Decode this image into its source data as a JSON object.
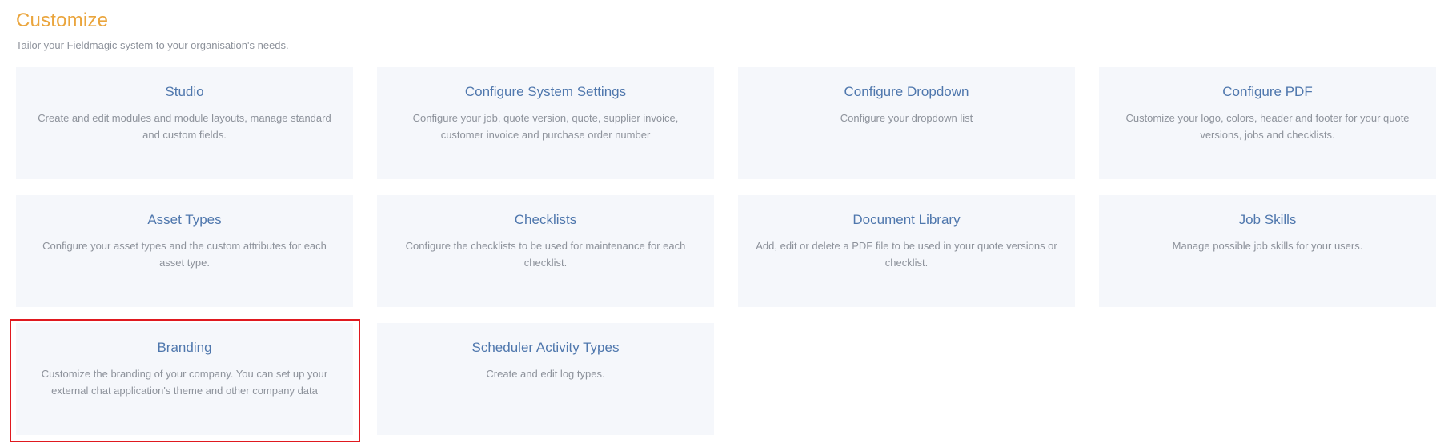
{
  "header": {
    "title": "Customize",
    "subtitle": "Tailor your Fieldmagic system to your organisation's needs."
  },
  "cards": [
    {
      "title": "Studio",
      "description": "Create and edit modules and module layouts, manage standard and custom fields."
    },
    {
      "title": "Configure System Settings",
      "description": "Configure your job, quote version, quote, supplier invoice, customer invoice and purchase order number"
    },
    {
      "title": "Configure Dropdown",
      "description": "Configure your dropdown list"
    },
    {
      "title": "Configure PDF",
      "description": "Customize your logo, colors, header and footer for your quote versions, jobs and checklists."
    },
    {
      "title": "Asset Types",
      "description": "Configure your asset types and the custom attributes for each asset type."
    },
    {
      "title": "Checklists",
      "description": "Configure the checklists to be used for maintenance for each checklist."
    },
    {
      "title": "Document Library",
      "description": "Add, edit or delete a PDF file to be used in your quote versions or checklist."
    },
    {
      "title": "Job Skills",
      "description": "Manage possible job skills for your users."
    },
    {
      "title": "Branding",
      "description": "Customize the branding of your company. You can set up your external chat application's theme and other company data"
    },
    {
      "title": "Scheduler Activity Types",
      "description": "Create and edit log types."
    }
  ],
  "colors": {
    "title": "#eaa53d",
    "card_title": "#4f77ad",
    "card_background": "#f5f7fb",
    "highlight_border": "#e0191f"
  }
}
